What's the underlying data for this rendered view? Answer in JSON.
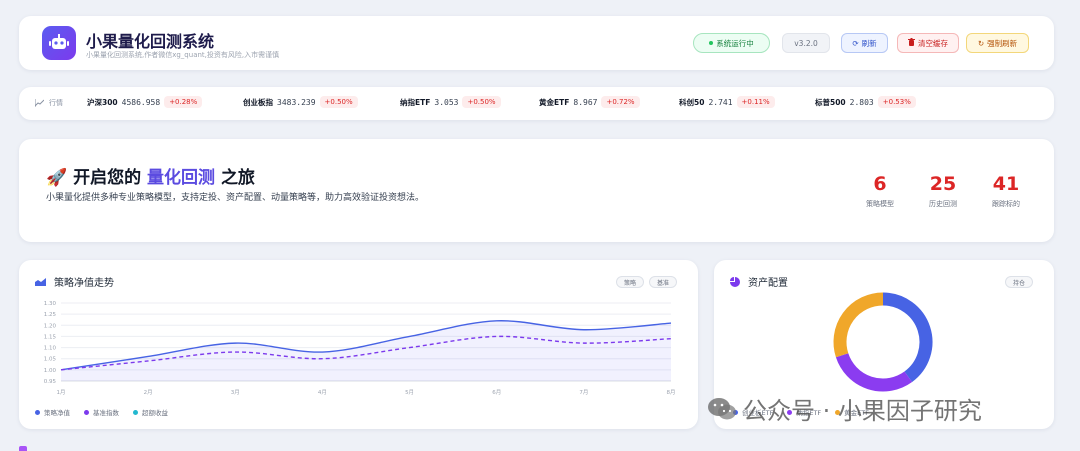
{
  "header": {
    "title": "小果量化回测系统",
    "subtitle": "小果量化回测系统,作者微信xg_quant,投资有风险,入市需谨慎",
    "status": "系统运行中",
    "version": "v3.2.0",
    "refresh_label": "刷新",
    "clear_cache_label": "清空缓存",
    "force_refresh_label": "强制刷新",
    "logo_icon": "robot-icon"
  },
  "ticker": {
    "label": "行情",
    "items": [
      {
        "name": "沪深300",
        "value": "4586.958",
        "change": "+0.28%"
      },
      {
        "name": "创业板指",
        "value": "3483.239",
        "change": "+0.50%"
      },
      {
        "name": "纳指ETF",
        "value": "3.053",
        "change": "+0.50%"
      },
      {
        "name": "黄金ETF",
        "value": "8.967",
        "change": "+0.72%"
      },
      {
        "name": "科创50",
        "value": "2.741",
        "change": "+0.11%"
      },
      {
        "name": "标普500",
        "value": "2.803",
        "change": "+0.53%"
      }
    ]
  },
  "hero": {
    "emoji": "🚀",
    "title_pre": "开启您的",
    "title_accent": "量化回测",
    "title_post": "之旅",
    "description": "小果量化提供多种专业策略模型，支持定投、资产配置、动量策略等，助力高效验证投资想法。",
    "stats": [
      {
        "value": "6",
        "label": "策略模型"
      },
      {
        "value": "25",
        "label": "历史回测"
      },
      {
        "value": "41",
        "label": "跟踪标的"
      }
    ]
  },
  "nav_card": {
    "title": "策略净值走势",
    "chips": [
      "策略",
      "基准"
    ]
  },
  "alloc_card": {
    "title": "资产配置",
    "chip": "持仓"
  },
  "chart_data": [
    {
      "type": "line",
      "x": [
        "1月",
        "2月",
        "3月",
        "4月",
        "5月",
        "6月",
        "7月",
        "8月"
      ],
      "yticks": [
        "0.95",
        "1.00",
        "1.05",
        "1.10",
        "1.15",
        "1.20",
        "1.25",
        "1.30"
      ],
      "ylim": [
        0.95,
        1.3
      ],
      "series": [
        {
          "name": "策略净值",
          "values": [
            1.0,
            1.06,
            1.12,
            1.08,
            1.15,
            1.22,
            1.18,
            1.21
          ],
          "color": "#4763e4",
          "style": "solid",
          "fill": true
        },
        {
          "name": "基准指数",
          "values": [
            1.0,
            1.04,
            1.08,
            1.05,
            1.1,
            1.15,
            1.12,
            1.14
          ],
          "color": "#7c3aed",
          "style": "dashed"
        },
        {
          "name": "超额收益",
          "values": [],
          "color": "#22b8cf",
          "style": "solid"
        }
      ],
      "grid": true,
      "legend": "bottom-left"
    },
    {
      "type": "pie",
      "donut": true,
      "categories": [
        "创业板ETF",
        "纳指ETF",
        "黄金ETF"
      ],
      "values": [
        40,
        30,
        30
      ],
      "colors": [
        "#4763e4",
        "#8b3cf0",
        "#f0a72a"
      ],
      "legend": "bottom"
    }
  ],
  "watermark": "公众号 · 小果因子研究"
}
